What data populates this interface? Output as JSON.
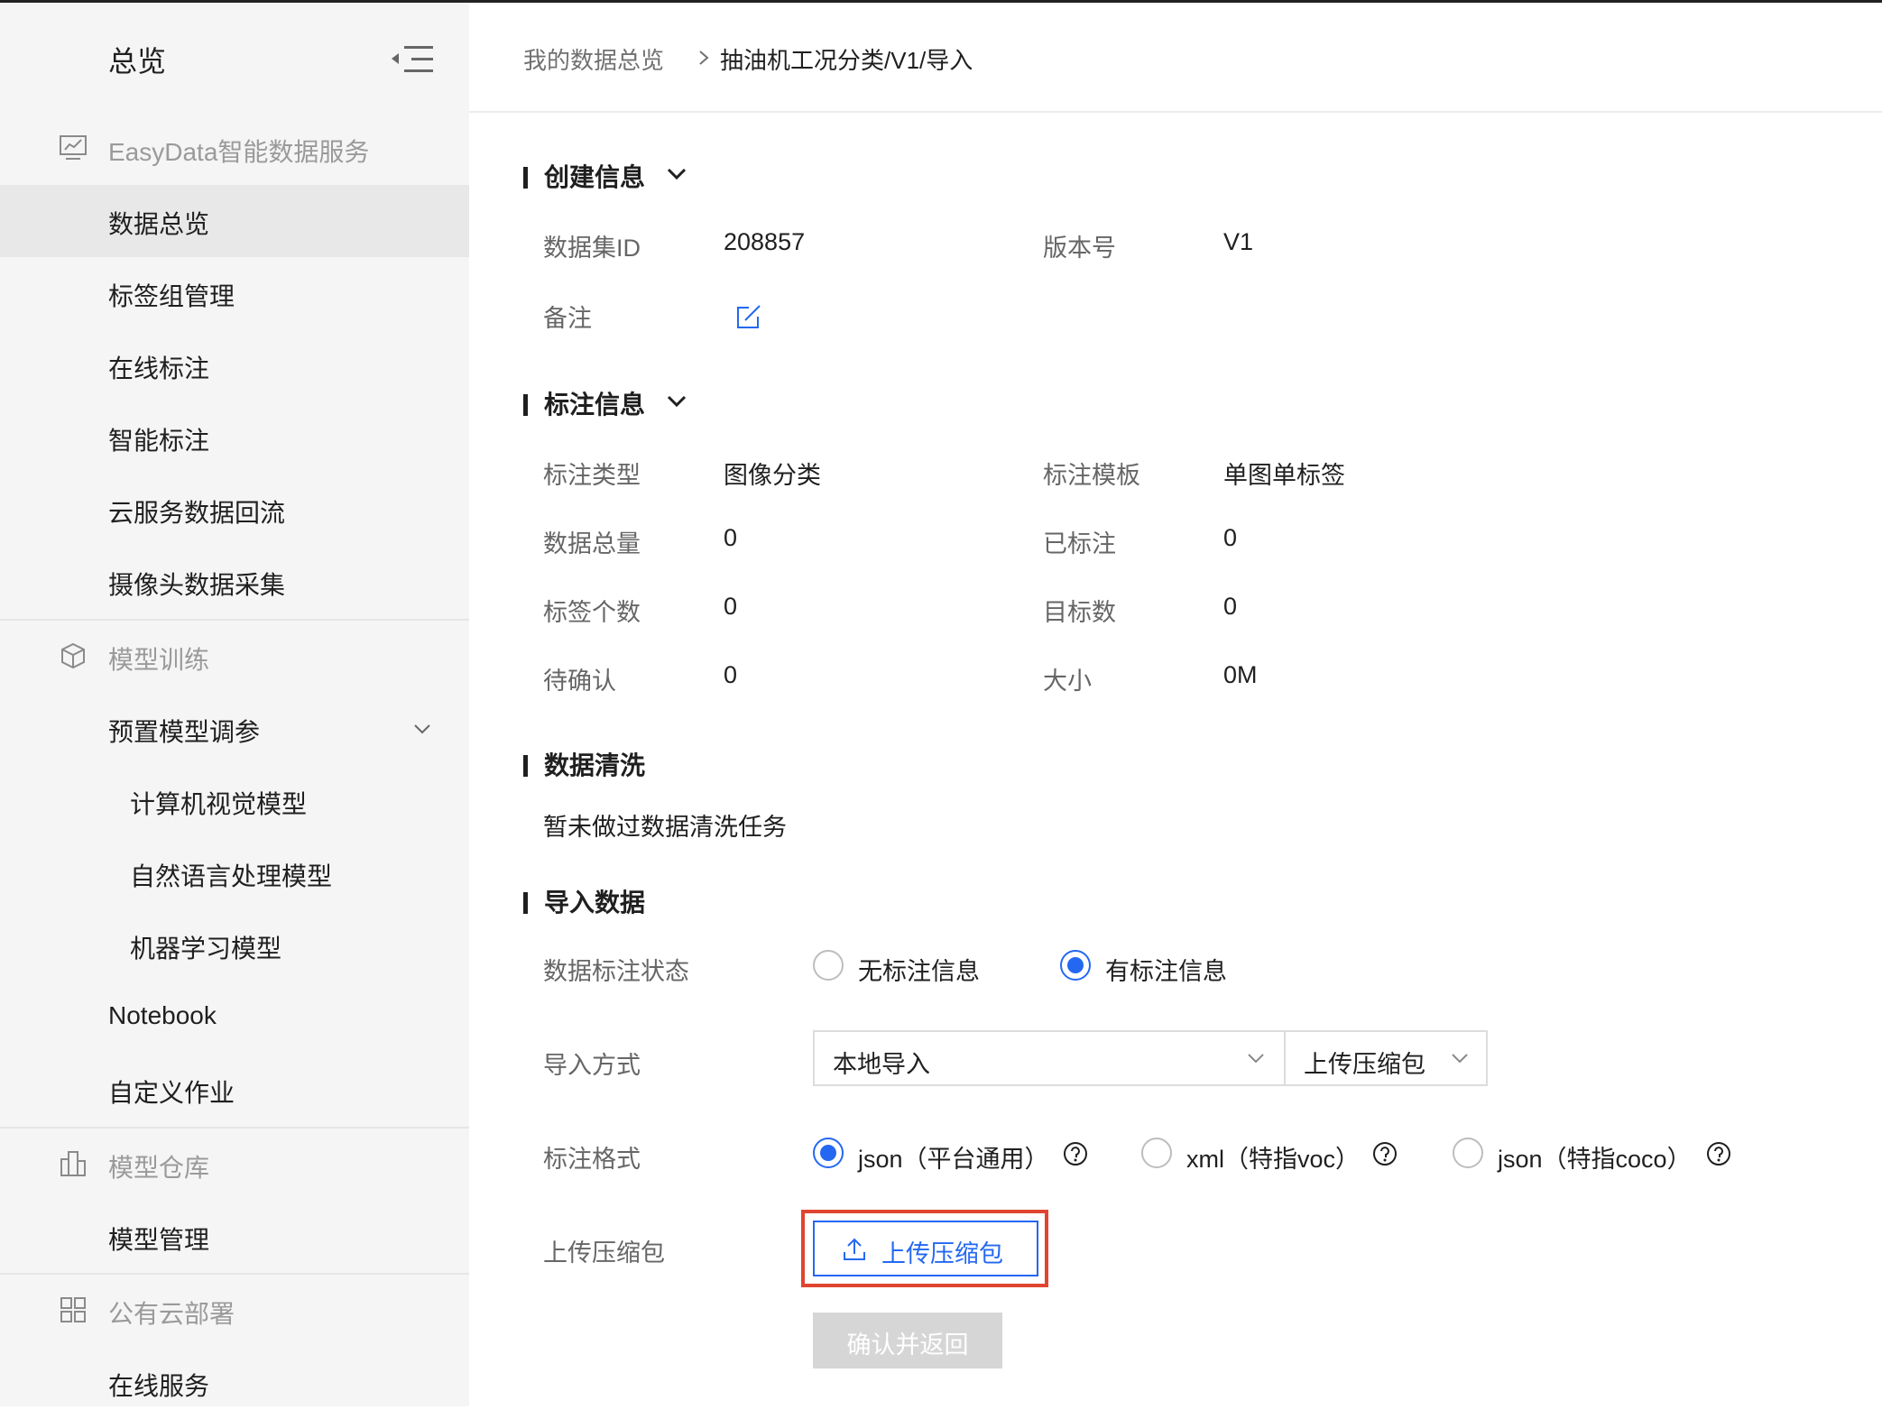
{
  "sidebar": {
    "title": "总览",
    "groups": {
      "easydata": {
        "label": "EasyData智能数据服务",
        "icon": "chart-monitor-icon"
      },
      "training": {
        "label": "模型训练",
        "icon": "cube-icon"
      },
      "warehouse": {
        "label": "模型仓库",
        "icon": "building-icon"
      },
      "deploy": {
        "label": "公有云部署",
        "icon": "deploy-icon"
      }
    },
    "items": {
      "data_overview": "数据总览",
      "tag_group": "标签组管理",
      "online_label": "在线标注",
      "smart_label": "智能标注",
      "cloud_flowback": "云服务数据回流",
      "camera_collect": "摄像头数据采集",
      "preset_tuning": "预置模型调参",
      "cv_model": "计算机视觉模型",
      "nlp_model": "自然语言处理模型",
      "ml_model": "机器学习模型",
      "notebook": "Notebook",
      "custom_job": "自定义作业",
      "model_mgmt": "模型管理",
      "online_service": "在线服务"
    }
  },
  "breadcrumb": {
    "parent": "我的数据总览",
    "current": "抽油机工况分类/V1/导入"
  },
  "create_info": {
    "title": "创建信息",
    "dataset_id_label": "数据集ID",
    "dataset_id": "208857",
    "version_label": "版本号",
    "version": "V1",
    "remark_label": "备注"
  },
  "label_info": {
    "title": "标注信息",
    "type_label": "标注类型",
    "type_value": "图像分类",
    "template_label": "标注模板",
    "template_value": "单图单标签",
    "total_label": "数据总量",
    "total_value": "0",
    "labeled_label": "已标注",
    "labeled_value": "0",
    "tag_count_label": "标签个数",
    "tag_count_value": "0",
    "target_label": "目标数",
    "target_value": "0",
    "pending_label": "待确认",
    "pending_value": "0",
    "size_label": "大小",
    "size_value": "0M"
  },
  "cleaning": {
    "title": "数据清洗",
    "text": "暂未做过数据清洗任务"
  },
  "import": {
    "title": "导入数据",
    "status_label": "数据标注状态",
    "status_options": [
      "无标注信息",
      "有标注信息"
    ],
    "status_selected": "有标注信息",
    "method_label": "导入方式",
    "method_value": "本地导入",
    "method_sub_value": "上传压缩包",
    "format_label": "标注格式",
    "format_options": [
      "json（平台通用）",
      "xml（特指voc）",
      "json（特指coco）"
    ],
    "format_selected": "json（平台通用）",
    "upload_label": "上传压缩包",
    "upload_button": "上传压缩包",
    "confirm_button": "确认并返回"
  },
  "colors": {
    "accent": "#2468f2",
    "highlight": "#e0452f",
    "sidebar_bg": "#f5f5f5",
    "disabled_btn": "#d6d6d6"
  }
}
